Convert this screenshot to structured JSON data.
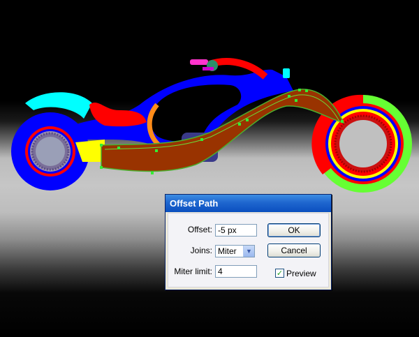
{
  "dialog": {
    "title": "Offset Path",
    "offset_label": "Offset:",
    "offset_value": "-5 px",
    "joins_label": "Joins:",
    "joins_value": "Miter",
    "miter_label": "Miter limit:",
    "miter_value": "4",
    "ok_label": "OK",
    "cancel_label": "Cancel",
    "preview_label": "Preview",
    "preview_checked": true
  },
  "icons": {
    "dropdown": "chevron-down-icon",
    "checkbox": "checkmark-icon"
  },
  "colors": {
    "wheel_outer": "#0000ff",
    "wheel_red": "#ff0000",
    "fender": "#00ffff",
    "seat": "#ff0000",
    "body": "#0000ff",
    "fork": "#993300",
    "front_ring": "#66ff33",
    "title_bar": "#1f66cf"
  }
}
